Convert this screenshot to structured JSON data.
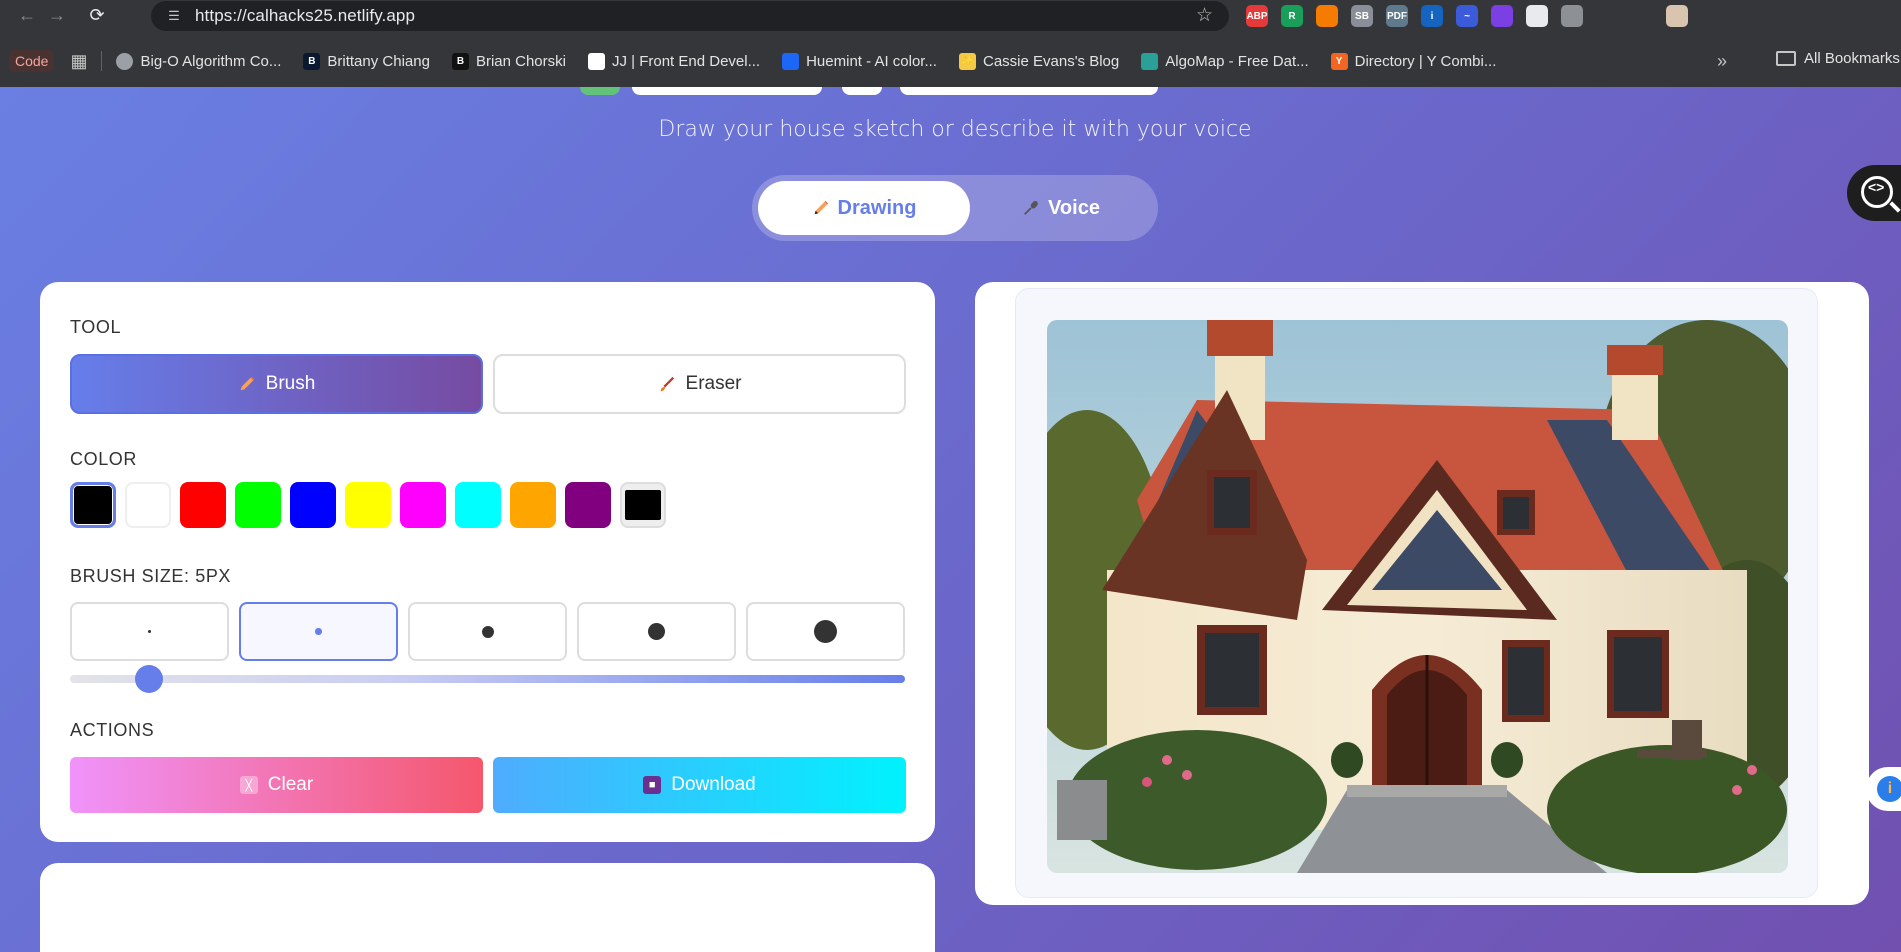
{
  "browser": {
    "url": "https://calhacks25.netlify.app",
    "extensions": [
      {
        "name": "abp",
        "label": "ABP",
        "color": "#e63a3a"
      },
      {
        "name": "r-ext",
        "label": "R",
        "color": "#1a9f5a"
      },
      {
        "name": "calendar-ext",
        "label": "",
        "color": "#f57c00"
      },
      {
        "name": "sb-ext",
        "label": "SB",
        "color": "#8a8e99"
      },
      {
        "name": "pdf-ext",
        "label": "PDF",
        "color": "#5f7a8c"
      },
      {
        "name": "info-ext",
        "label": "i",
        "color": "#1565c0"
      },
      {
        "name": "wave-ext",
        "label": "~",
        "color": "#3b5bdb"
      },
      {
        "name": "chat-ext",
        "label": "",
        "color": "#7b3fe4"
      },
      {
        "name": "openai-ext",
        "label": "",
        "color": "#e8eaed"
      },
      {
        "name": "edit-ext",
        "label": "",
        "color": "#8d9196"
      },
      {
        "name": "puzzle-ext",
        "label": "",
        "color": "#35363a"
      },
      {
        "name": "search-ext",
        "label": "",
        "color": "#35363a"
      },
      {
        "name": "profile-avatar",
        "label": "",
        "color": "#d9c4b0"
      }
    ],
    "bookmarks": {
      "code": "Code",
      "items": [
        {
          "label": "Big-O Algorithm Co...",
          "icon": "globe-icon",
          "color": "#9aa0a6",
          "glyph": ""
        },
        {
          "label": "Brittany Chiang",
          "icon": "b-icon",
          "color": "#0a192f",
          "glyph": "B"
        },
        {
          "label": "Brian Chorski",
          "icon": "b-icon",
          "color": "#111111",
          "glyph": "B"
        },
        {
          "label": "JJ | Front End Devel...",
          "icon": "page-icon",
          "color": "#ffffff",
          "glyph": ""
        },
        {
          "label": "Huemint - AI color...",
          "icon": "huemint-icon",
          "color": "#1e66f5",
          "glyph": ""
        },
        {
          "label": "Cassie Evans's Blog",
          "icon": "sparkle-icon",
          "color": "#f6c945",
          "glyph": "✨"
        },
        {
          "label": "AlgoMap - Free Dat...",
          "icon": "algomap-icon",
          "color": "#2aa198",
          "glyph": ""
        },
        {
          "label": "Directory | Y Combi...",
          "icon": "yc-icon",
          "color": "#f26522",
          "glyph": "Y"
        }
      ],
      "all_bookmarks": "All Bookmarks"
    }
  },
  "page": {
    "subtitle": "Draw your house sketch or describe it with your voice",
    "modes": {
      "drawing": "Drawing",
      "voice": "Voice",
      "active": "drawing"
    },
    "controls": {
      "tool_label": "TOOL",
      "tools": {
        "brush": "Brush",
        "eraser": "Eraser",
        "active": "brush"
      },
      "color_label": "COLOR",
      "colors": [
        "#000000",
        "#ffffff",
        "#ff0000",
        "#00ff00",
        "#0000ff",
        "#ffff00",
        "#ff00ff",
        "#00ffff",
        "#ffa500",
        "#800080"
      ],
      "selected_color": "#000000",
      "picker_color": "#000000",
      "brush_size_label": "BRUSH SIZE: 5PX",
      "brush_size_value": 5,
      "brush_sizes": [
        2,
        5,
        10,
        15,
        20
      ],
      "actions_label": "ACTIONS",
      "actions": {
        "clear": "Clear",
        "download": "Download"
      }
    }
  }
}
